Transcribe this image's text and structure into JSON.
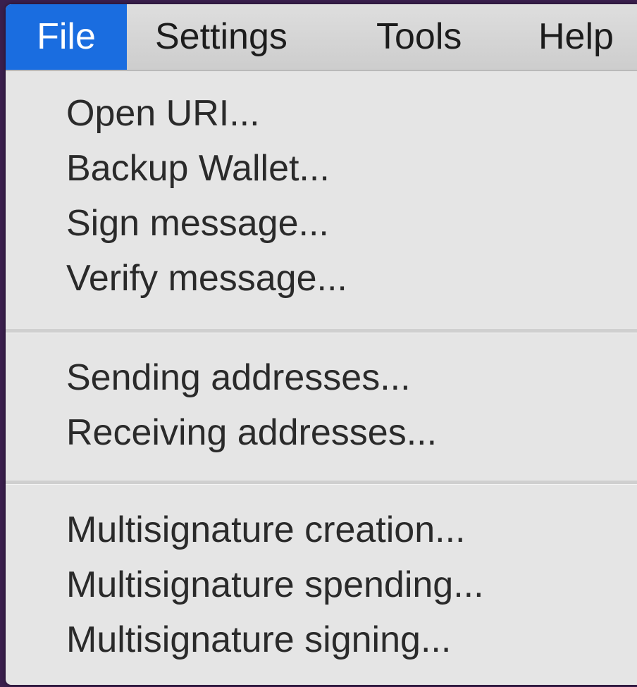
{
  "menubar": {
    "items": [
      {
        "label": "File",
        "active": true
      },
      {
        "label": "Settings",
        "active": false
      },
      {
        "label": "Tools",
        "active": false
      },
      {
        "label": "Help",
        "active": false
      }
    ]
  },
  "menu": {
    "groups": [
      {
        "items": [
          "Open URI...",
          "Backup Wallet...",
          "Sign message...",
          "Verify message..."
        ]
      },
      {
        "items": [
          "Sending addresses...",
          "Receiving addresses..."
        ]
      },
      {
        "items": [
          "Multisignature creation...",
          "Multisignature spending...",
          "Multisignature signing..."
        ]
      }
    ]
  },
  "colors": {
    "active_menu": "#1a6de0",
    "menu_background": "#e5e5e5",
    "desktop": "#3a1f4d"
  }
}
